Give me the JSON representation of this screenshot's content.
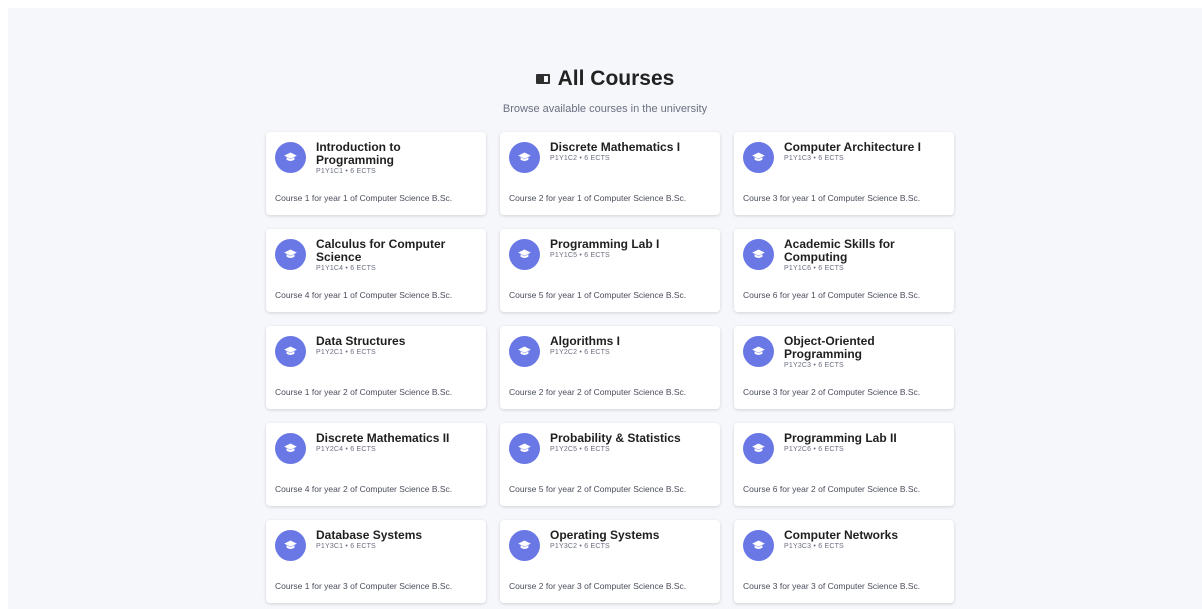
{
  "header": {
    "title": "All Courses",
    "title_icon": "book-icon",
    "subtitle": "Browse available courses in the university"
  },
  "theme": {
    "accent": "#6a78e6",
    "background": "#f6f7fb",
    "card": "#ffffff"
  },
  "courses": [
    {
      "name": "Introduction to Programming",
      "meta": "P1Y1C1 • 6 ECTS",
      "description": "Course 1 for year 1 of Computer Science B.Sc.",
      "icon": "graduation-cap-icon"
    },
    {
      "name": "Discrete Mathematics I",
      "meta": "P1Y1C2 • 6 ECTS",
      "description": "Course 2 for year 1 of Computer Science B.Sc.",
      "icon": "graduation-cap-icon"
    },
    {
      "name": "Computer Architecture I",
      "meta": "P1Y1C3 • 6 ECTS",
      "description": "Course 3 for year 1 of Computer Science B.Sc.",
      "icon": "graduation-cap-icon"
    },
    {
      "name": "Calculus for Computer Science",
      "meta": "P1Y1C4 • 6 ECTS",
      "description": "Course 4 for year 1 of Computer Science B.Sc.",
      "icon": "graduation-cap-icon"
    },
    {
      "name": "Programming Lab I",
      "meta": "P1Y1C5 • 6 ECTS",
      "description": "Course 5 for year 1 of Computer Science B.Sc.",
      "icon": "graduation-cap-icon"
    },
    {
      "name": "Academic Skills for Computing",
      "meta": "P1Y1C6 • 6 ECTS",
      "description": "Course 6 for year 1 of Computer Science B.Sc.",
      "icon": "graduation-cap-icon"
    },
    {
      "name": "Data Structures",
      "meta": "P1Y2C1 • 6 ECTS",
      "description": "Course 1 for year 2 of Computer Science B.Sc.",
      "icon": "graduation-cap-icon"
    },
    {
      "name": "Algorithms I",
      "meta": "P1Y2C2 • 6 ECTS",
      "description": "Course 2 for year 2 of Computer Science B.Sc.",
      "icon": "graduation-cap-icon"
    },
    {
      "name": "Object-Oriented Programming",
      "meta": "P1Y2C3 • 6 ECTS",
      "description": "Course 3 for year 2 of Computer Science B.Sc.",
      "icon": "graduation-cap-icon"
    },
    {
      "name": "Discrete Mathematics II",
      "meta": "P1Y2C4 • 6 ECTS",
      "description": "Course 4 for year 2 of Computer Science B.Sc.",
      "icon": "graduation-cap-icon"
    },
    {
      "name": "Probability & Statistics",
      "meta": "P1Y2C5 • 6 ECTS",
      "description": "Course 5 for year 2 of Computer Science B.Sc.",
      "icon": "graduation-cap-icon"
    },
    {
      "name": "Programming Lab II",
      "meta": "P1Y2C6 • 6 ECTS",
      "description": "Course 6 for year 2 of Computer Science B.Sc.",
      "icon": "graduation-cap-icon"
    },
    {
      "name": "Database Systems",
      "meta": "P1Y3C1 • 6 ECTS",
      "description": "Course 1 for year 3 of Computer Science B.Sc.",
      "icon": "graduation-cap-icon"
    },
    {
      "name": "Operating Systems",
      "meta": "P1Y3C2 • 6 ECTS",
      "description": "Course 2 for year 3 of Computer Science B.Sc.",
      "icon": "graduation-cap-icon"
    },
    {
      "name": "Computer Networks",
      "meta": "P1Y3C3 • 6 ECTS",
      "description": "Course 3 for year 3 of Computer Science B.Sc.",
      "icon": "graduation-cap-icon"
    }
  ]
}
